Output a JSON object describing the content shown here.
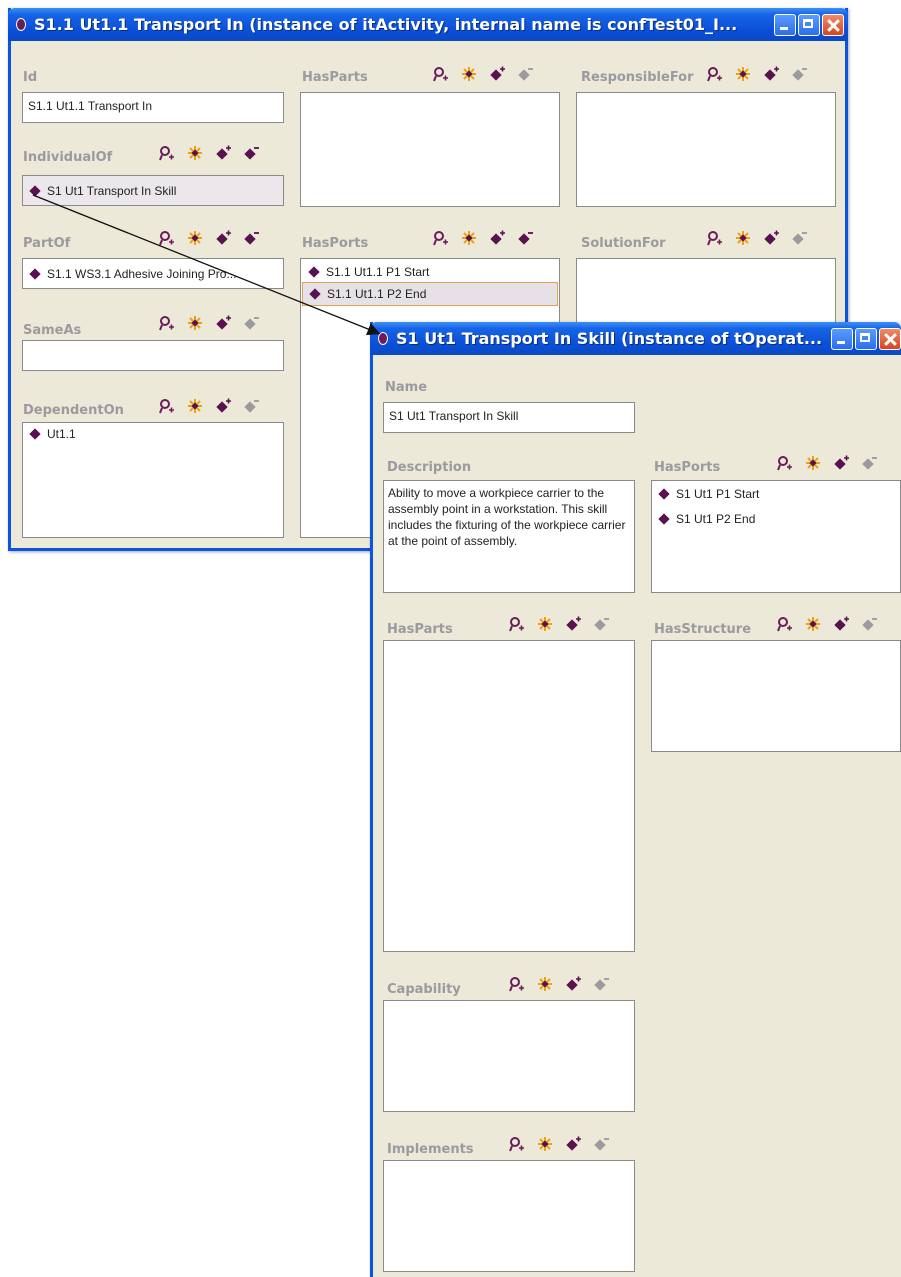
{
  "window1": {
    "title": "S1.1 Ut1.1 Transport In   (instance of itActivity, internal name is confTest01_I...",
    "id": {
      "label": "Id",
      "value": "S1.1 Ut1.1 Transport In"
    },
    "individual_of": {
      "label": "IndividualOf",
      "item": "S1 Ut1 Transport In Skill"
    },
    "part_of": {
      "label": "PartOf",
      "item": "S1.1 WS3.1 Adhesive Joining Pro..."
    },
    "same_as": {
      "label": "SameAs",
      "value": ""
    },
    "dependent_on": {
      "label": "DependentOn",
      "items": [
        "Ut1.1"
      ]
    },
    "has_parts": {
      "label": "HasParts",
      "items": []
    },
    "has_ports": {
      "label": "HasPorts",
      "items": [
        "S1.1 Ut1.1 P1 Start",
        "S1.1 Ut1.1 P2 End"
      ]
    },
    "responsible_for": {
      "label": "ResponsibleFor",
      "items": []
    },
    "solution_for": {
      "label": "SolutionFor",
      "items": []
    }
  },
  "window2": {
    "title": "S1 Ut1 Transport In Skill  (instance of tOperat...",
    "name": {
      "label": "Name",
      "value": "S1 Ut1 Transport In Skill"
    },
    "description": {
      "label": "Description",
      "value": "Ability to move a workpiece carrier to the assembly point in a workstation. This skill includes the fixturing of the workpiece carrier at the point of assembly."
    },
    "has_ports": {
      "label": "HasPorts",
      "items": [
        "S1 Ut1 P1 Start",
        "S1 Ut1 P2 End"
      ]
    },
    "has_parts": {
      "label": "HasParts",
      "items": []
    },
    "has_structure": {
      "label": "HasStructure",
      "items": []
    },
    "capability": {
      "label": "Capability",
      "items": []
    },
    "implements": {
      "label": "Implements",
      "items": []
    }
  },
  "icons": [
    "find-instance-icon",
    "create-instance-icon",
    "add-instance-icon",
    "remove-instance-icon"
  ],
  "colors": {
    "titlebar": "#0a4fd6",
    "window_bg": "#ece9d8",
    "label": "#9a9aa0",
    "instance_diamond": "#5a1150",
    "selection_border": "#e3a34a"
  }
}
